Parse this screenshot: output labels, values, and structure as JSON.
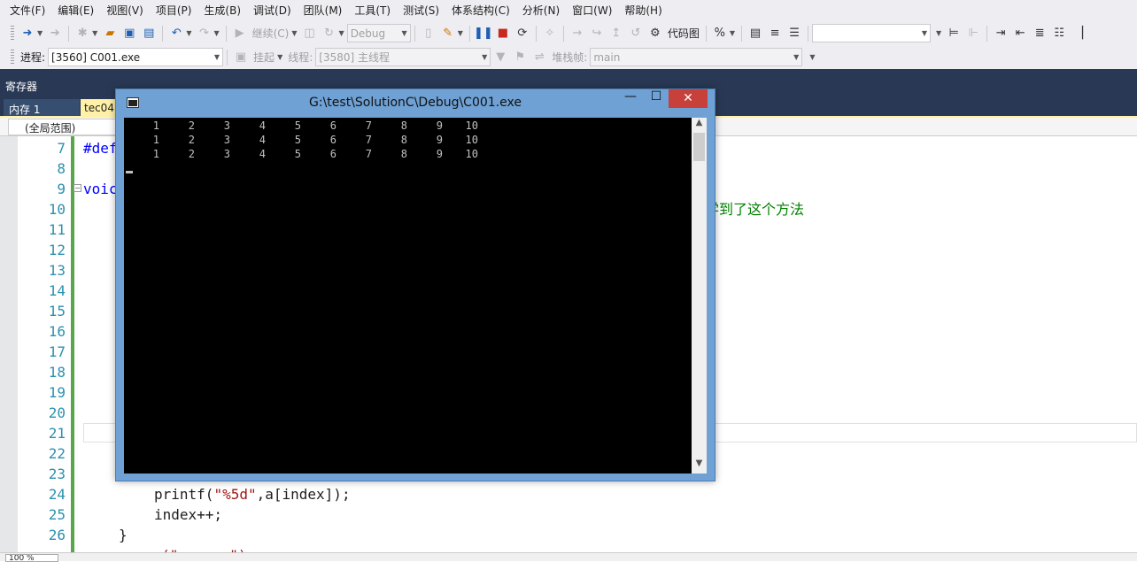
{
  "menu": [
    "文件(F)",
    "编辑(E)",
    "视图(V)",
    "项目(P)",
    "生成(B)",
    "调试(D)",
    "团队(M)",
    "工具(T)",
    "测试(S)",
    "体系结构(C)",
    "分析(N)",
    "窗口(W)",
    "帮助(H)"
  ],
  "toolbar1": {
    "continue_label": "继续(C)",
    "config_value": "Debug",
    "codemap_label": "代码图"
  },
  "toolbar2": {
    "process_label": "进程:",
    "process_value": "[3560] C001.exe",
    "suspend_label": "挂起",
    "thread_label": "线程:",
    "thread_value": "[3580] 主线程",
    "stackframe_label": "堆栈帧:",
    "stackframe_value": "main"
  },
  "panel": {
    "register_title": "寄存器",
    "tab_memory": "内存 1",
    "tab_file": "tec04.",
    "scope_value": "(全局范围)"
  },
  "editor": {
    "line_numbers": [
      "7",
      "8",
      "9",
      "10",
      "11",
      "12",
      "13",
      "14",
      "15",
      "16",
      "17",
      "18",
      "19",
      "20",
      "21",
      "22",
      "23",
      "24",
      "25",
      "26"
    ],
    "code": {
      "l7": "#def",
      "l9": "voic",
      "l10_comment": "学到了这个方法",
      "l24_a": "printf(",
      "l24_str": "\"%5d\"",
      "l24_b": ",a[index]);",
      "l25": "index++;",
      "l26": "}",
      "l27_partial": "     (\"      \")"
    }
  },
  "status": {
    "zoom": "100 %"
  },
  "console": {
    "title": "G:\\test\\SolutionC\\Debug\\C001.exe",
    "close_glyph": "✕",
    "rows": [
      [
        "1",
        "2",
        "3",
        "4",
        "5",
        "6",
        "7",
        "8",
        "9",
        "10"
      ],
      [
        "1",
        "2",
        "3",
        "4",
        "5",
        "6",
        "7",
        "8",
        "9",
        "10"
      ],
      [
        "1",
        "2",
        "3",
        "4",
        "5",
        "6",
        "7",
        "8",
        "9",
        "10"
      ]
    ]
  },
  "colors": {
    "ide_background": "#eeeef2",
    "panel_navy": "#293955",
    "active_tab": "#fff1a8",
    "line_number": "#2b91af",
    "change_bar": "#57a64a",
    "keyword": "#0000ff",
    "string": "#a31515",
    "comment": "#008000",
    "console_frame": "#6fa1d4",
    "console_close": "#c7403a"
  },
  "icons": [
    "back-arrow-icon",
    "forward-arrow-icon",
    "new-project-icon",
    "open-folder-icon",
    "save-icon",
    "save-all-icon",
    "undo-icon",
    "redo-icon",
    "continue-play-icon",
    "break-all-icon",
    "stop-debugging-icon",
    "restart-icon",
    "step-into-icon",
    "step-over-icon",
    "step-out-icon",
    "codemap-icon",
    "comment-icon",
    "uncomment-icon",
    "indent-icon",
    "outdent-icon",
    "process-icon",
    "thread-filter-icon"
  ]
}
